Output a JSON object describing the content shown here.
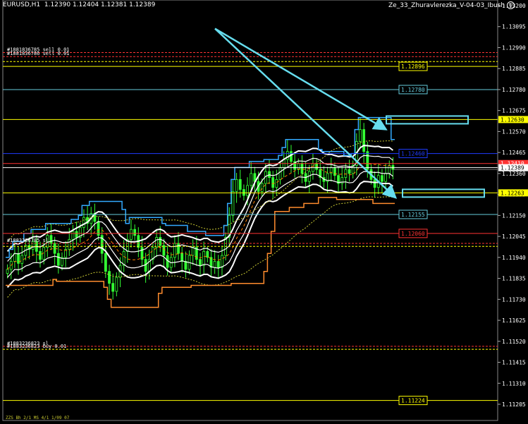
{
  "header": {
    "symbol_tf": "EURUSD,H1",
    "ohlc": "1.12390 1.12404 1.12381 1.12389",
    "expert": "Ze_33_Zhuravlerezka_V-04-03_Ibush"
  },
  "colors": {
    "background": "#000000",
    "candles": "#33ff33",
    "axis_text": "#ffffff",
    "yellow_level": "#ffff00",
    "cyan_level": "#66ccdd",
    "blue_level": "#1f3cff",
    "red_level": "#ff3333",
    "orange_line": "#ff8c2e",
    "bands": "#ffffff",
    "arrows": "#66ddee"
  },
  "chart_data": {
    "type": "candlestick",
    "symbol": "EURUSD",
    "timeframe": "H1",
    "price_axis_ticks": [
      "1.13200",
      "1.13095",
      "1.12990",
      "1.12885",
      "1.12780",
      "1.12675",
      "1.12570",
      "1.12465",
      "1.12360",
      "1.12255",
      "1.12150",
      "1.12045",
      "1.11940",
      "1.11835",
      "1.11730",
      "1.11625",
      "1.11520",
      "1.11415",
      "1.11310",
      "1.11205"
    ],
    "ylim": [
      1.1115,
      1.1325
    ],
    "levels": [
      {
        "price": 1.12896,
        "label": "1.12896",
        "color": "#ffff00",
        "style": "solid"
      },
      {
        "price": 1.1278,
        "label": "1.12780",
        "color": "#66ccdd",
        "style": "solid"
      },
      {
        "price": 1.1263,
        "label": "1.12630",
        "color": "#ffff00",
        "style": "solid",
        "badge": true
      },
      {
        "price": 1.1246,
        "label": "1.12460",
        "color": "#1f3cff",
        "style": "solid"
      },
      {
        "price": 1.1241,
        "label": "1.12410",
        "color": "#ff3333",
        "style": "solid",
        "badge": true
      },
      {
        "price": 1.12389,
        "label": "1.12389",
        "color": "#ffffff",
        "style": "solid",
        "badge": true
      },
      {
        "price": 1.12263,
        "label": "1.12263",
        "color": "#ffff00",
        "style": "solid",
        "badge": true
      },
      {
        "price": 1.12155,
        "label": "1.12155",
        "color": "#66ccdd",
        "style": "solid"
      },
      {
        "price": 1.1206,
        "label": "1.12060",
        "color": "#ff3333",
        "style": "solid"
      },
      {
        "price": 1.11224,
        "label": "1.11224",
        "color": "#ffff00",
        "style": "solid"
      }
    ],
    "order_lines": [
      {
        "price": 1.12965,
        "text": "#1881836785 sell 0.01",
        "color": "#ff3333"
      },
      {
        "price": 1.12945,
        "text": "#1881836786 sell 0.01",
        "color": "#ff3333"
      },
      {
        "price": 1.1292,
        "text": "",
        "color": "#ffff00"
      },
      {
        "price": 1.1201,
        "text": "#1883336785 sl",
        "color": "#ff3333"
      },
      {
        "price": 1.11995,
        "text": "",
        "color": "#ffff00"
      },
      {
        "price": 1.11495,
        "text": "#1883236823 sl",
        "color": "#ff3333"
      },
      {
        "price": 1.1148,
        "text": "#1883236823 buy 0.01",
        "color": "#ffff00"
      }
    ],
    "closes": [
      1.1188,
      1.1192,
      1.1196,
      1.1191,
      1.1195,
      1.12,
      1.1198,
      1.1202,
      1.1197,
      1.1193,
      1.1199,
      1.1205,
      1.1201,
      1.1196,
      1.119,
      1.1194,
      1.1198,
      1.1203,
      1.1207,
      1.1204,
      1.1209,
      1.1214,
      1.1211,
      1.1216,
      1.1212,
      1.1205,
      1.1196,
      1.1187,
      1.1181,
      1.1177,
      1.1184,
      1.119,
      1.1197,
      1.1203,
      1.1208,
      1.1205,
      1.1199,
      1.1193,
      1.1187,
      1.1193,
      1.1199,
      1.1204,
      1.12,
      1.1195,
      1.1189,
      1.1194,
      1.1201,
      1.1196,
      1.1192,
      1.1188,
      1.1195,
      1.1199,
      1.1193,
      1.119,
      1.1197,
      1.1194,
      1.1189,
      1.1192,
      1.1189,
      1.1195,
      1.1204,
      1.1215,
      1.1227,
      1.1233,
      1.1228,
      1.1225,
      1.123,
      1.1236,
      1.1232,
      1.1227,
      1.1231,
      1.1237,
      1.1234,
      1.1229,
      1.1233,
      1.1239,
      1.1243,
      1.1247,
      1.1242,
      1.1238,
      1.1241,
      1.1236,
      1.1232,
      1.1237,
      1.1241,
      1.1238,
      1.1234,
      1.1232,
      1.1236,
      1.1239,
      1.1235,
      1.1231,
      1.1234,
      1.1238,
      1.1236,
      1.124,
      1.1252,
      1.1258,
      1.1247,
      1.1238,
      1.1233,
      1.1229,
      1.1235,
      1.1232,
      1.1236,
      1.124,
      1.1238
    ],
    "annotations": [
      {
        "type": "arrow",
        "from": [
          1.13085,
          0.13
        ],
        "to": [
          1.12585,
          0.77
        ]
      },
      {
        "type": "arrow",
        "from": [
          1.13085,
          0.13
        ],
        "to": [
          1.12245,
          0.79
        ]
      }
    ]
  },
  "footer": {
    "indicator_text": "ZZS Bh 2/1 MS 4/1 1/09 07"
  }
}
